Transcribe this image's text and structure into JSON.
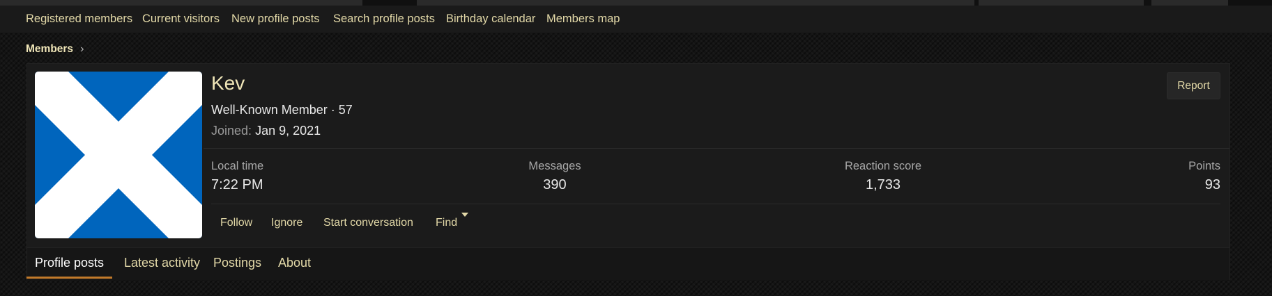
{
  "subnav": [
    "Registered members",
    "Current visitors",
    "New profile posts",
    "Search profile posts",
    "Birthday calendar",
    "Members map"
  ],
  "breadcrumb": {
    "label": "Members"
  },
  "profile": {
    "name": "Kev",
    "title": "Well-Known Member · 57",
    "joined_label": "Joined:",
    "joined_value": "Jan 9, 2021",
    "avatar_icon": "saltire-flag-icon",
    "report_label": "Report"
  },
  "stats": [
    {
      "label": "Local time",
      "value": "7:22 PM"
    },
    {
      "label": "Messages",
      "value": "390"
    },
    {
      "label": "Reaction score",
      "value": "1,733"
    },
    {
      "label": "Points",
      "value": "93"
    }
  ],
  "actions": {
    "follow": "Follow",
    "ignore": "Ignore",
    "start_conversation": "Start conversation",
    "find": "Find"
  },
  "tabs": [
    {
      "label": "Profile posts",
      "active": true
    },
    {
      "label": "Latest activity",
      "active": false
    },
    {
      "label": "Postings",
      "active": false
    },
    {
      "label": "About",
      "active": false
    }
  ],
  "colors": {
    "accent": "#c27a2b",
    "link": "#e3d9a8",
    "flag_blue": "#0065bd"
  }
}
